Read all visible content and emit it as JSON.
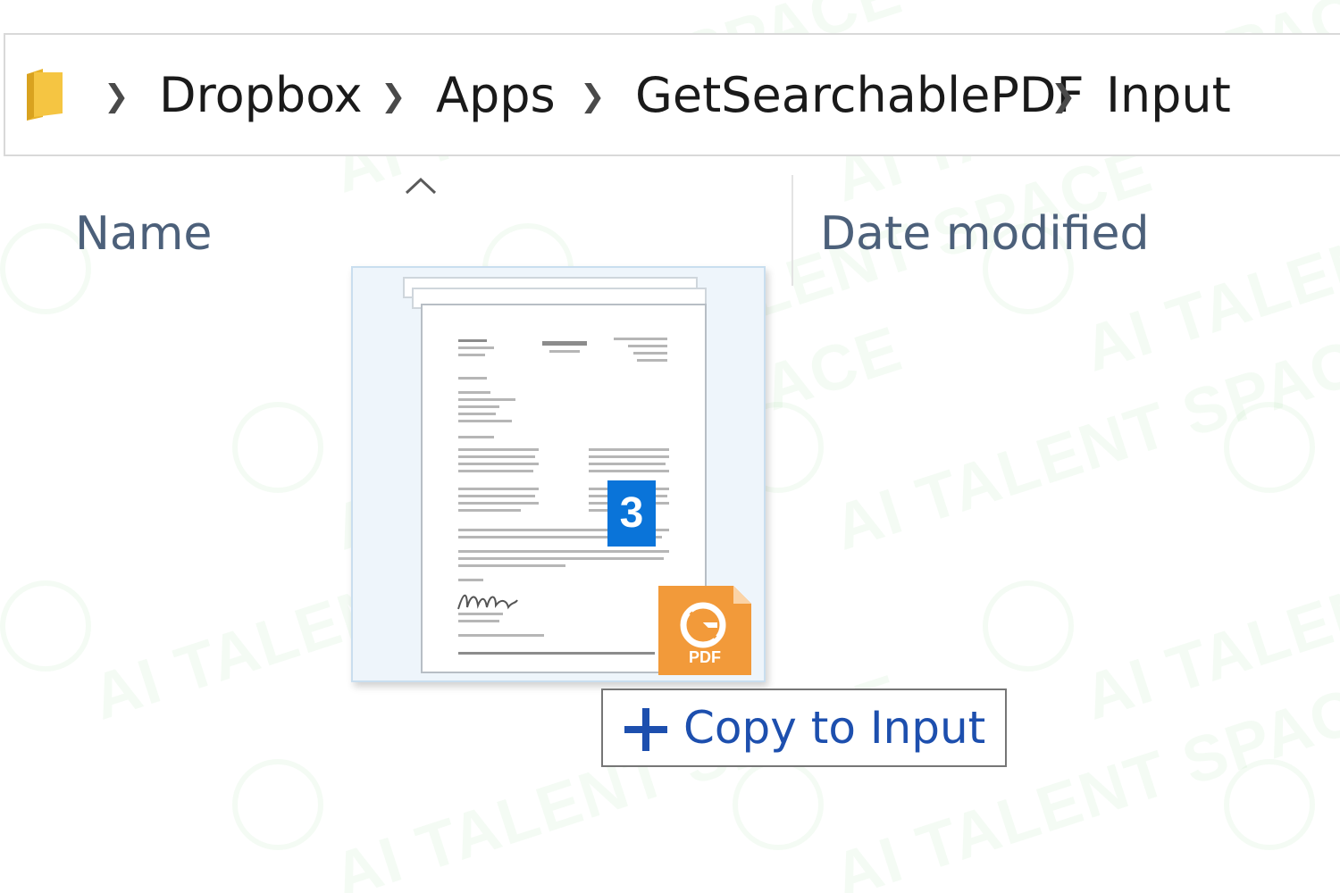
{
  "breadcrumb": {
    "items": [
      {
        "label": "Dropbox"
      },
      {
        "label": "Apps"
      },
      {
        "label": "GetSearchablePDF"
      },
      {
        "label": "Input"
      }
    ],
    "folder_icon": "folder-icon",
    "separator_icon": "chevron-right-icon"
  },
  "columns": {
    "name": "Name",
    "date_modified": "Date modified",
    "sort_indicator": "sort-ascending-icon"
  },
  "drag": {
    "item_count": "3",
    "file_type_label": "PDF",
    "file_type_icon": "pdf-file-icon",
    "tooltip_action": "Copy to Input",
    "tooltip_icon": "plus-icon"
  },
  "watermark": "AI TALENT SPACE",
  "colors": {
    "badge": "#0a74d9",
    "pdf_icon": "#f29a3a",
    "tooltip_text": "#1d4fae",
    "header_text": "#4c607a",
    "folder": "#f5c542"
  }
}
